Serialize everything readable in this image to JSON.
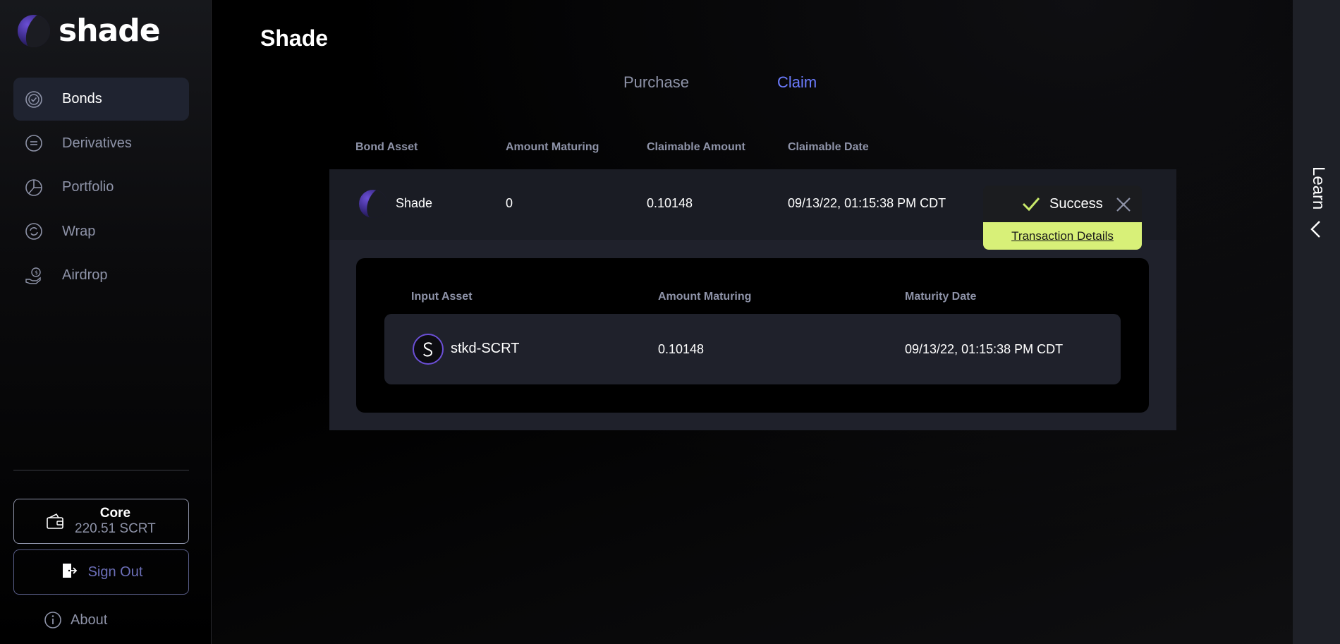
{
  "app": {
    "logo_text": "shade",
    "page_title": "Shade"
  },
  "sidebar": {
    "items": [
      {
        "label": "Bonds",
        "icon": "bonds-icon",
        "active": true
      },
      {
        "label": "Derivatives",
        "icon": "derivatives-icon",
        "active": false
      },
      {
        "label": "Portfolio",
        "icon": "portfolio-icon",
        "active": false
      },
      {
        "label": "Wrap",
        "icon": "wrap-icon",
        "active": false
      },
      {
        "label": "Airdrop",
        "icon": "airdrop-icon",
        "active": false
      }
    ],
    "wallet": {
      "name": "Core",
      "balance": "220.51 SCRT"
    },
    "sign_out_label": "Sign Out",
    "about_label": "About"
  },
  "tabs": [
    {
      "label": "Purchase",
      "active": false
    },
    {
      "label": "Claim",
      "active": true
    }
  ],
  "bond_table": {
    "headers": [
      "Bond Asset",
      "Amount Maturing",
      "Claimable Amount",
      "Claimable Date"
    ],
    "row": {
      "asset": "Shade",
      "amount_maturing": "0",
      "claimable_amount": "0.10148",
      "claimable_date": "09/13/22, 01:15:38 PM CDT"
    }
  },
  "detail_table": {
    "headers": [
      "Input Asset",
      "Amount Maturing",
      "Maturity Date"
    ],
    "row": {
      "asset": "stkd-SCRT",
      "amount_maturing": "0.10148",
      "maturity_date": "09/13/22, 01:15:38 PM CDT"
    }
  },
  "toast": {
    "status": "Success",
    "link_label": "Transaction Details"
  },
  "learn_drawer": {
    "label": "Learn"
  },
  "colors": {
    "accent": "#6c7cff",
    "toast_bg": "#d8f078",
    "success_check": "#c8e86a"
  }
}
